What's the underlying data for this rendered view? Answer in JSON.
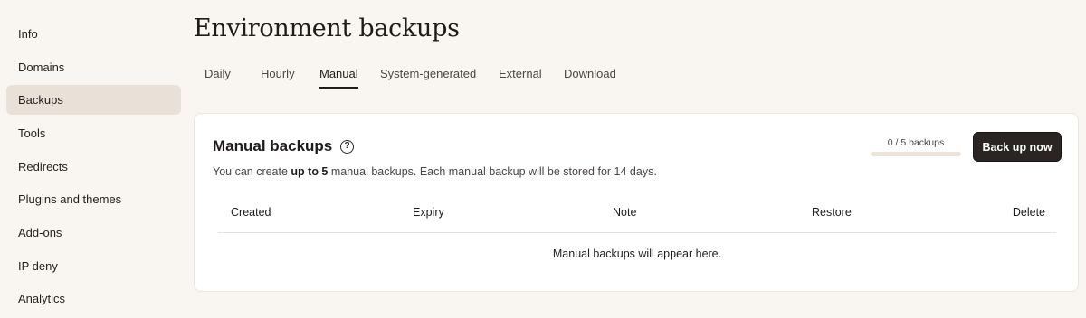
{
  "sidebar": {
    "items": [
      {
        "label": "Info"
      },
      {
        "label": "Domains"
      },
      {
        "label": "Backups"
      },
      {
        "label": "Tools"
      },
      {
        "label": "Redirects"
      },
      {
        "label": "Plugins and themes"
      },
      {
        "label": "Add-ons"
      },
      {
        "label": "IP deny"
      },
      {
        "label": "Analytics"
      }
    ],
    "active": "Backups"
  },
  "page": {
    "title": "Environment backups"
  },
  "tabs": [
    {
      "label": "Daily"
    },
    {
      "label": "Hourly"
    },
    {
      "label": "Manual"
    },
    {
      "label": "System-generated"
    },
    {
      "label": "External"
    },
    {
      "label": "Download"
    }
  ],
  "active_tab": "Manual",
  "card": {
    "title": "Manual backups",
    "help_icon": "question-circle-icon",
    "desc_prefix": "You can create ",
    "desc_bold": "up to 5",
    "desc_suffix": " manual backups. Each manual backup will be stored for 14 days.",
    "usage_label": "0 / 5 backups",
    "usage_used": 0,
    "usage_max": 5,
    "backup_button": "Back up now",
    "columns": [
      "Created",
      "Expiry",
      "Note",
      "Restore",
      "Delete"
    ],
    "empty_message": "Manual backups will appear here."
  },
  "colors": {
    "background": "#f9f6f2",
    "sidebar_active": "#e9e1d8",
    "button": "#2a2523",
    "progress_track": "#ece3da"
  }
}
